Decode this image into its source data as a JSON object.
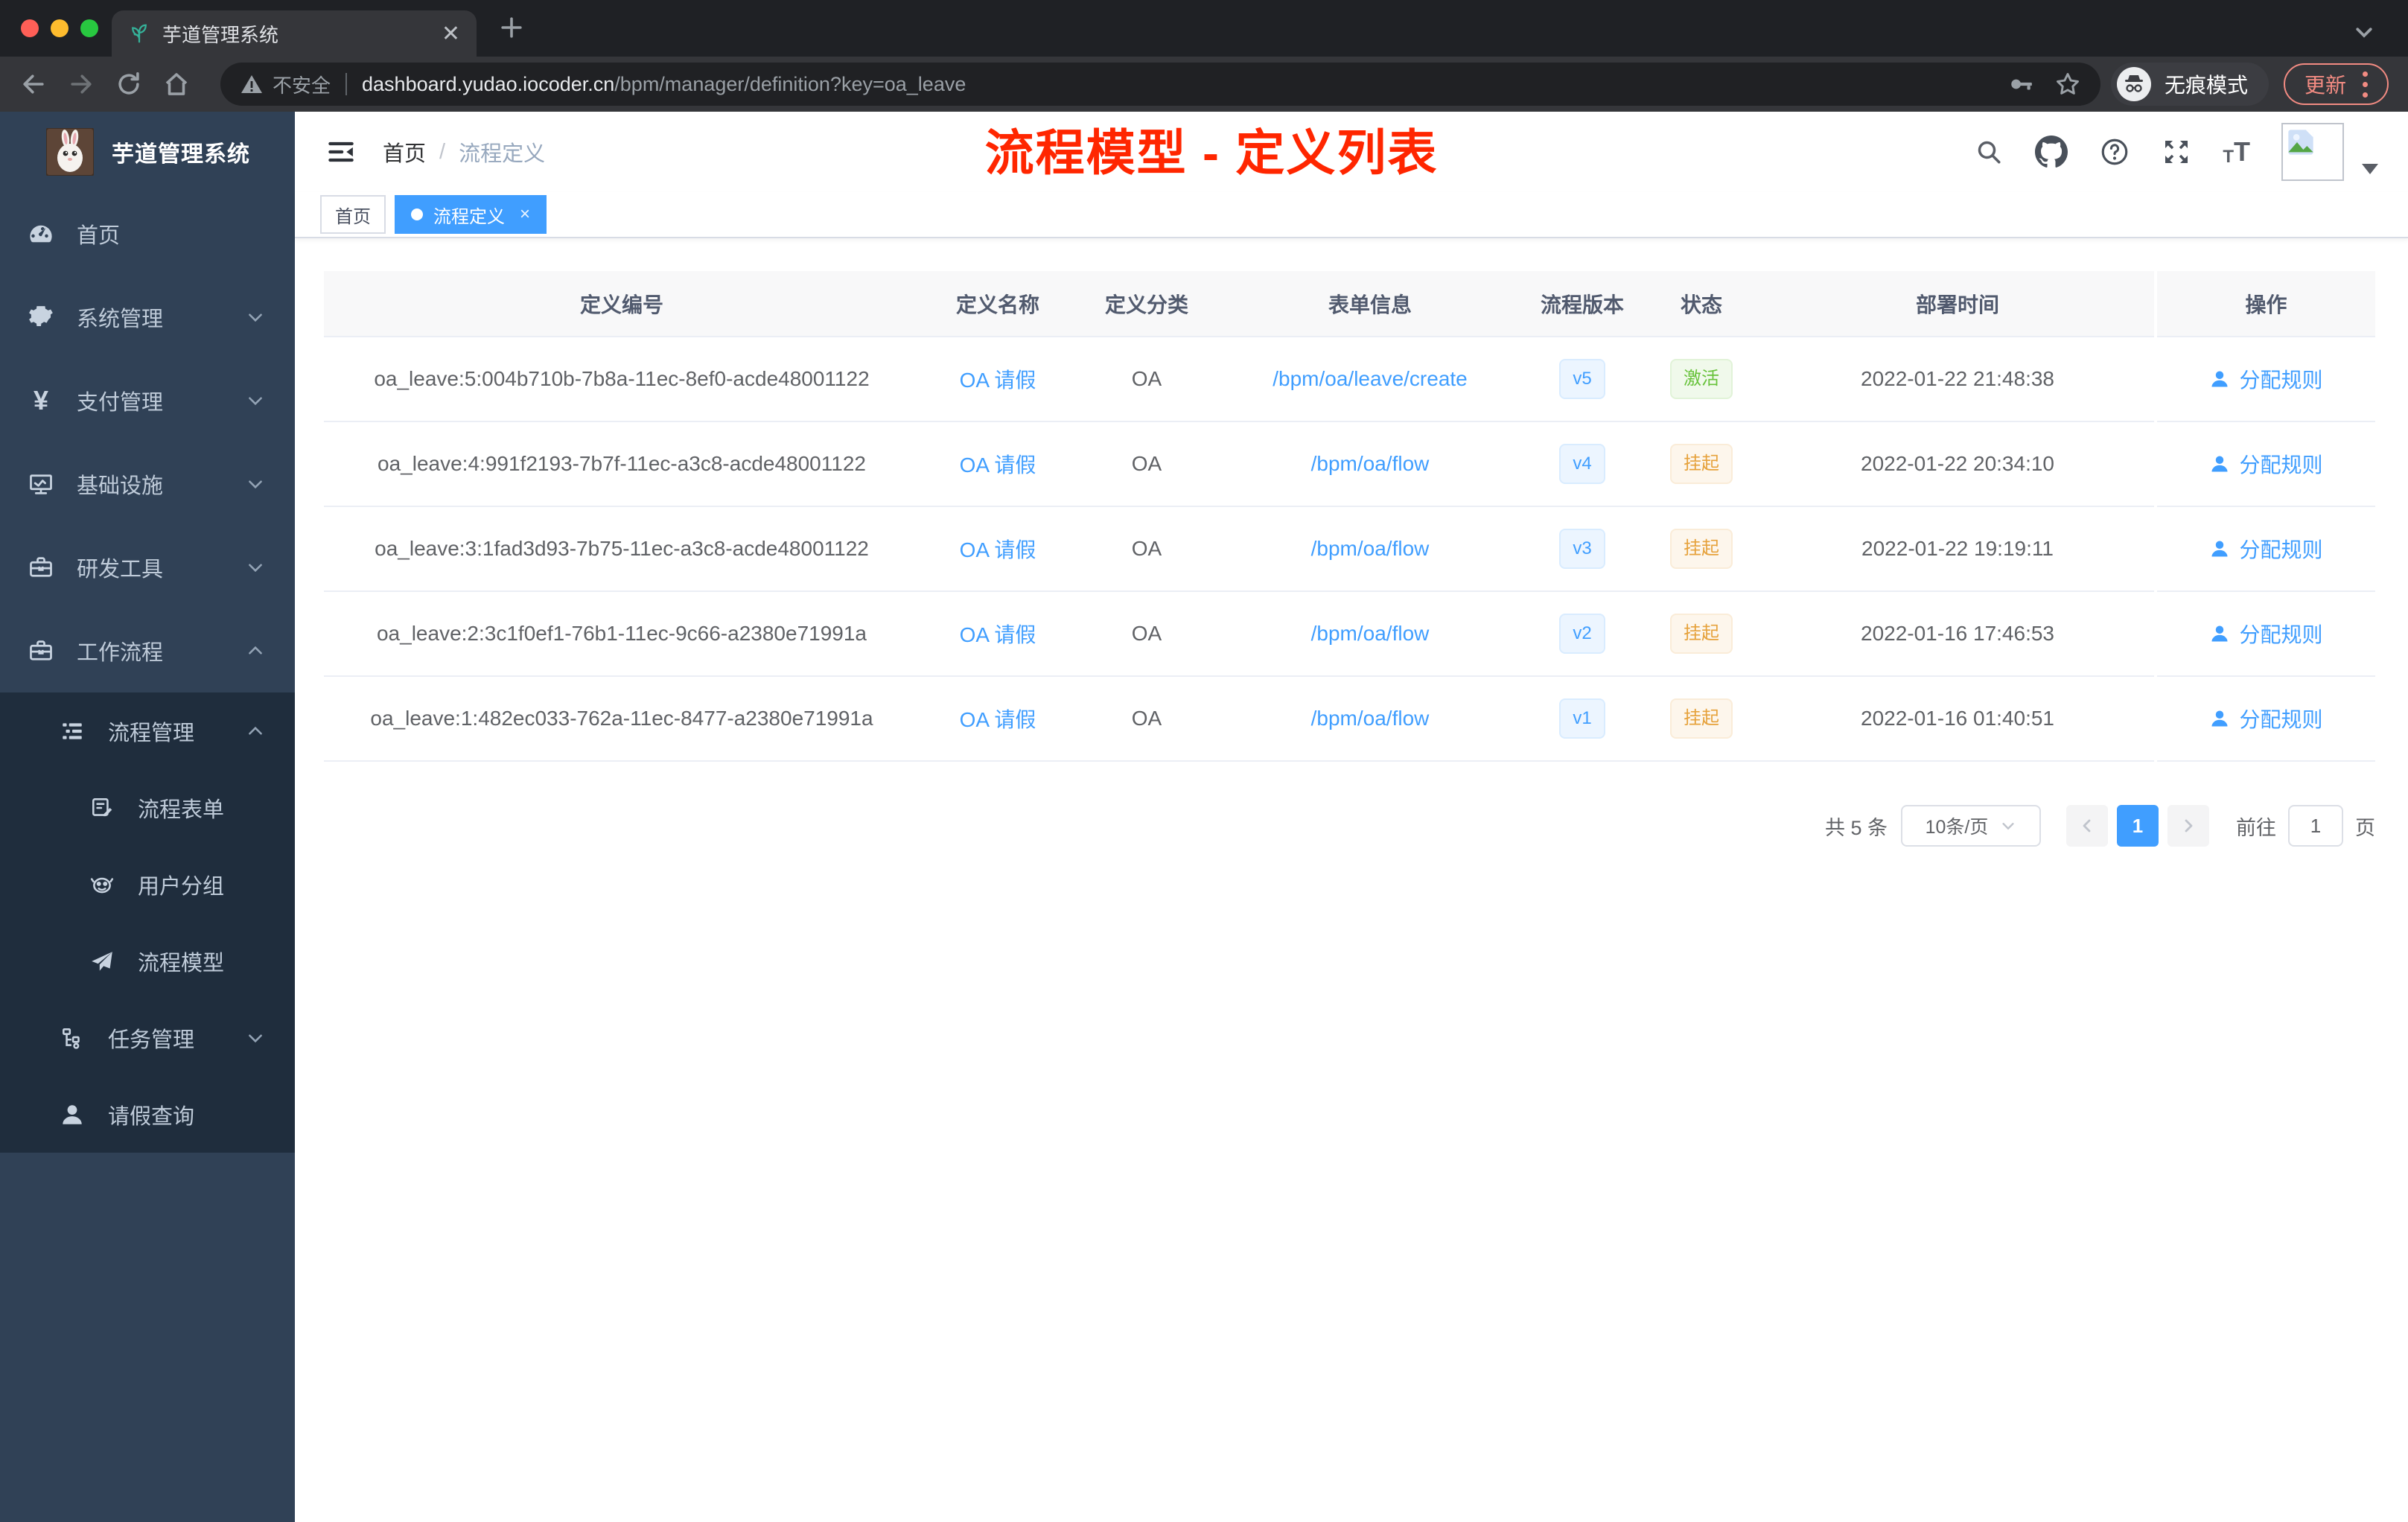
{
  "browser": {
    "tab_title": "芋道管理系统",
    "insecure_label": "不安全",
    "url_host": "dashboard.yudao.iocoder.cn",
    "url_path": "/bpm/manager/definition?key=oa_leave",
    "incognito_label": "无痕模式",
    "update_label": "更新"
  },
  "sidebar": {
    "title": "芋道管理系统",
    "items": [
      {
        "label": "首页"
      },
      {
        "label": "系统管理"
      },
      {
        "label": "支付管理"
      },
      {
        "label": "基础设施"
      },
      {
        "label": "研发工具"
      },
      {
        "label": "工作流程"
      },
      {
        "label": "流程管理"
      },
      {
        "label": "流程表单"
      },
      {
        "label": "用户分组"
      },
      {
        "label": "流程模型"
      },
      {
        "label": "任务管理"
      },
      {
        "label": "请假查询"
      }
    ]
  },
  "breadcrumb": {
    "home": "首页",
    "current": "流程定义"
  },
  "annotation": "流程模型 - 定义列表",
  "tags": {
    "home": "首页",
    "active": "流程定义",
    "close": "×"
  },
  "table": {
    "columns": [
      "定义编号",
      "定义名称",
      "定义分类",
      "表单信息",
      "流程版本",
      "状态",
      "部署时间",
      "操作"
    ],
    "rows": [
      {
        "id": "oa_leave:5:004b710b-7b8a-11ec-8ef0-acde48001122",
        "name": "OA 请假",
        "category": "OA",
        "form": "/bpm/oa/leave/create",
        "version": "v5",
        "status": "激活",
        "deployed": "2022-01-22 21:48:38",
        "action": "分配规则"
      },
      {
        "id": "oa_leave:4:991f2193-7b7f-11ec-a3c8-acde48001122",
        "name": "OA 请假",
        "category": "OA",
        "form": "/bpm/oa/flow",
        "version": "v4",
        "status": "挂起",
        "deployed": "2022-01-22 20:34:10",
        "action": "分配规则"
      },
      {
        "id": "oa_leave:3:1fad3d93-7b75-11ec-a3c8-acde48001122",
        "name": "OA 请假",
        "category": "OA",
        "form": "/bpm/oa/flow",
        "version": "v3",
        "status": "挂起",
        "deployed": "2022-01-22 19:19:11",
        "action": "分配规则"
      },
      {
        "id": "oa_leave:2:3c1f0ef1-76b1-11ec-9c66-a2380e71991a",
        "name": "OA 请假",
        "category": "OA",
        "form": "/bpm/oa/flow",
        "version": "v2",
        "status": "挂起",
        "deployed": "2022-01-16 17:46:53",
        "action": "分配规则"
      },
      {
        "id": "oa_leave:1:482ec033-762a-11ec-8477-a2380e71991a",
        "name": "OA 请假",
        "category": "OA",
        "form": "/bpm/oa/flow",
        "version": "v1",
        "status": "挂起",
        "deployed": "2022-01-16 01:40:51",
        "action": "分配规则"
      }
    ]
  },
  "pagination": {
    "total": "共 5 条",
    "page_size": "10条/页",
    "page": "1",
    "goto_label": "前往",
    "goto_value": "1",
    "unit": "页"
  },
  "colors": {
    "accent": "#409eff",
    "success": "#67c23a",
    "warning": "#e6a23c",
    "annotation_red": "#ff2600",
    "sidebar_bg": "#304156",
    "submenu_bg": "#1f2d3d"
  }
}
